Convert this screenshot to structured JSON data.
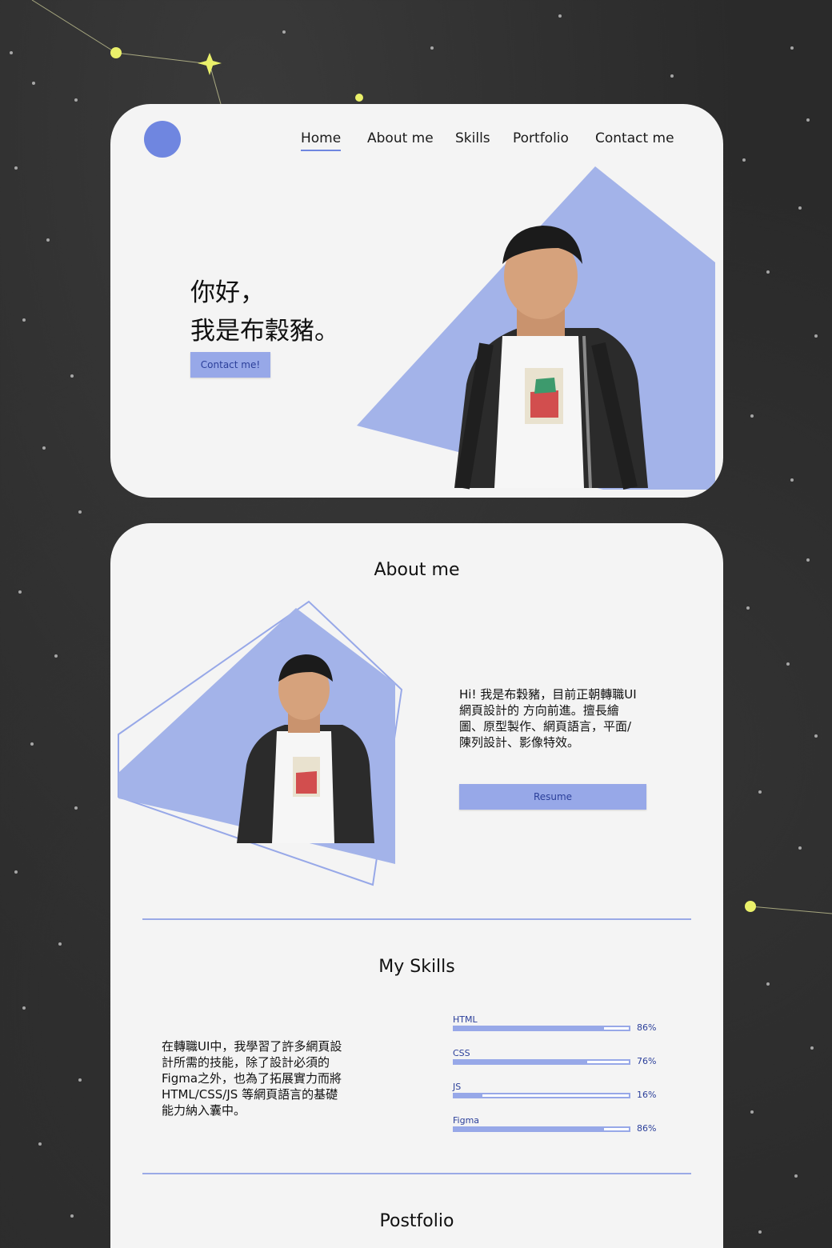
{
  "nav": {
    "home": "Home",
    "about": "About me",
    "skills": "Skills",
    "portfolio": "Portfolio",
    "contact": "Contact me"
  },
  "hero": {
    "line1": "你好，",
    "line2": "我是布穀豬。",
    "button": "Contact me!"
  },
  "about": {
    "title": "About me",
    "text_lines": [
      "Hi! 我是布穀豬，目前正朝轉職UI",
      "網頁設計的 方向前進。擅長繪",
      "圖、原型製作、網頁語言，平面/",
      "陳列設計、影像特效。"
    ],
    "resume_button": "Resume"
  },
  "skills": {
    "title": "My Skills",
    "text_lines": [
      "在轉職UI中，我學習了許多網頁設",
      "計所需的技能，除了設計必須的",
      "Figma之外，也為了拓展實力而將",
      "HTML/CSS/JS 等網頁語言的基礎",
      "能力納入囊中。"
    ],
    "items": [
      {
        "name": "HTML",
        "percent": 86,
        "label": "86%"
      },
      {
        "name": "CSS",
        "percent": 76,
        "label": "76%"
      },
      {
        "name": "JS",
        "percent": 16,
        "label": "16%"
      },
      {
        "name": "Figma",
        "percent": 86,
        "label": "86%"
      }
    ]
  },
  "portfolio": {
    "title": "Postfolio"
  },
  "colors": {
    "accent": "#6f86e0",
    "accent_light": "#97a8e8",
    "card": "#f4f4f4",
    "background": "#2a2a2a"
  }
}
